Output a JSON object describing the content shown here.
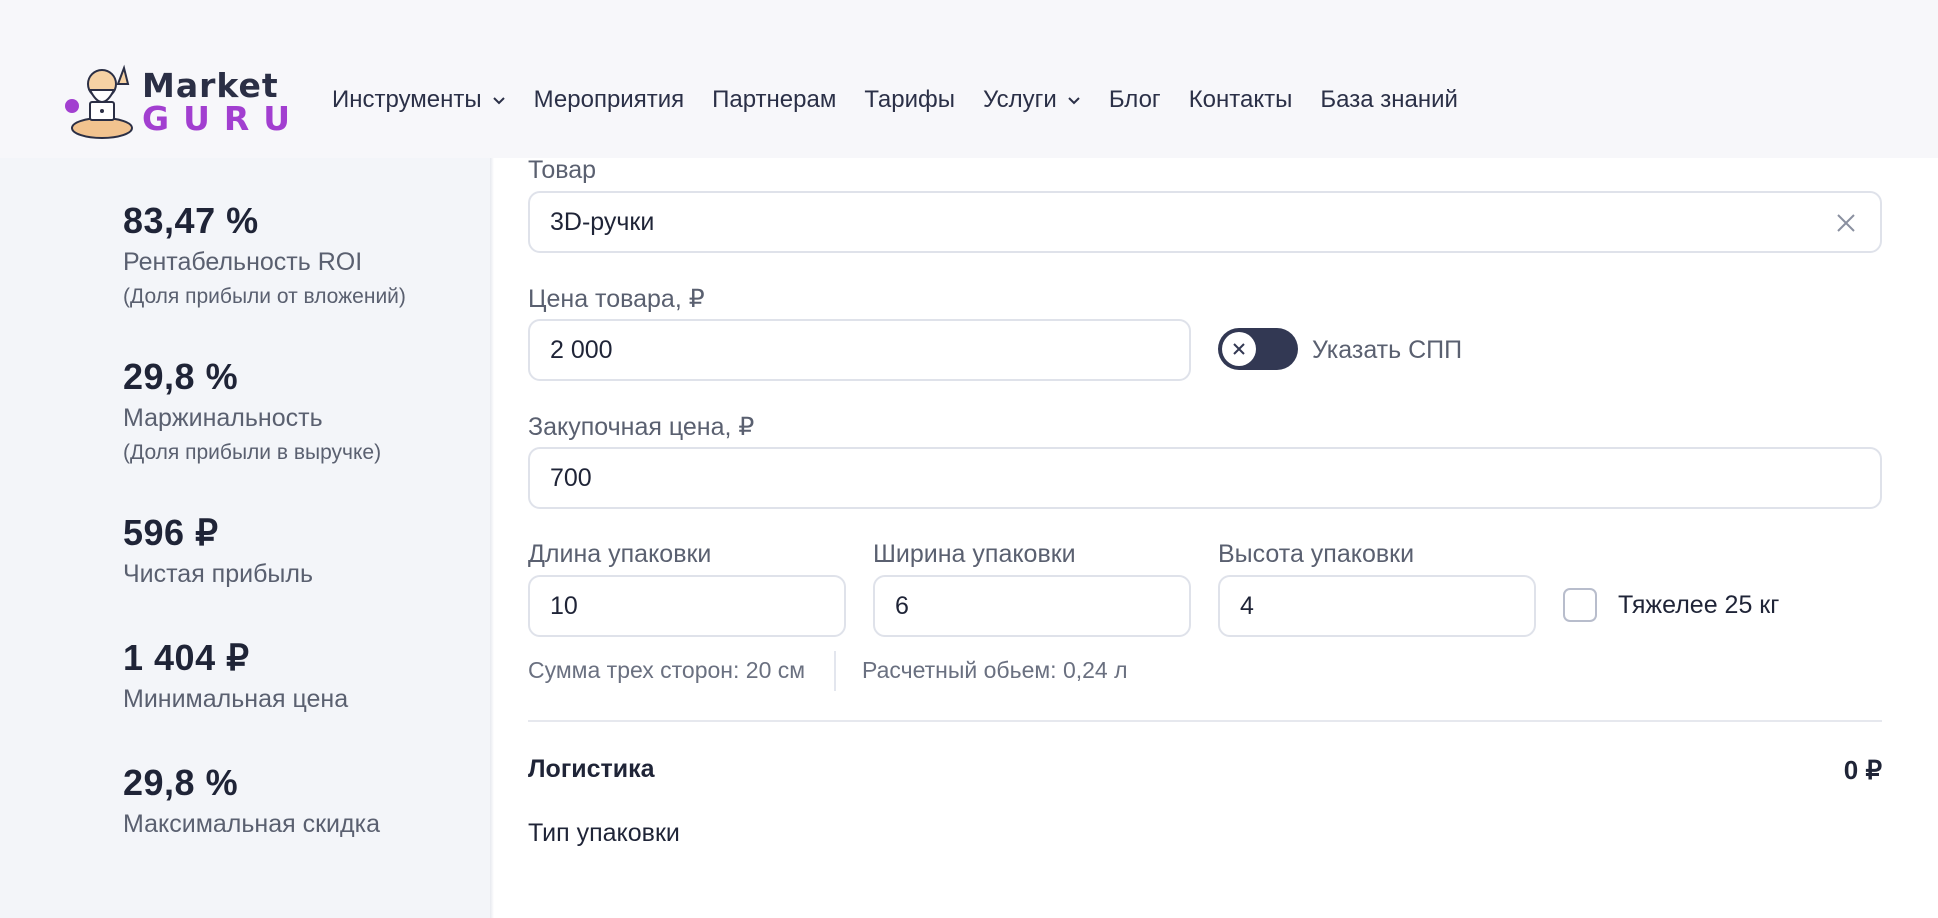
{
  "brand": {
    "line1": "Market",
    "line2": "GURU",
    "accent_color": "#a23fd0"
  },
  "nav": [
    {
      "label": "Инструменты",
      "dropdown": true
    },
    {
      "label": "Мероприятия",
      "dropdown": false
    },
    {
      "label": "Партнерам",
      "dropdown": false
    },
    {
      "label": "Тарифы",
      "dropdown": false
    },
    {
      "label": "Услуги",
      "dropdown": true
    },
    {
      "label": "Блог",
      "dropdown": false
    },
    {
      "label": "Контакты",
      "dropdown": false
    },
    {
      "label": "База знаний",
      "dropdown": false
    }
  ],
  "metrics": [
    {
      "value": "83,47 %",
      "label": "Рентабельность ROI",
      "sub": "(Доля прибыли от вложений)"
    },
    {
      "value": "29,8 %",
      "label": "Маржинальность",
      "sub": "(Доля прибыли в выручке)"
    },
    {
      "value": "596 ₽",
      "label": "Чистая прибыль",
      "sub": ""
    },
    {
      "value": "1 404 ₽",
      "label": "Минимальная цена",
      "sub": ""
    },
    {
      "value": "29,8 %",
      "label": "Максимальная скидка",
      "sub": ""
    }
  ],
  "form": {
    "product": {
      "label": "Товар",
      "value": "3D-ручки"
    },
    "price": {
      "label": "Цена товара, ₽",
      "value": "2 000"
    },
    "spp_toggle": {
      "label": "Указать СПП",
      "on": false
    },
    "purchase_price": {
      "label": "Закупочная цена, ₽",
      "value": "700"
    },
    "length": {
      "label": "Длина упаковки",
      "value": "10"
    },
    "width": {
      "label": "Ширина упаковки",
      "value": "6"
    },
    "height": {
      "label": "Высота упаковки",
      "value": "4"
    },
    "heavy": {
      "label": "Тяжелее 25 кг",
      "checked": false
    },
    "sum_sides": "Сумма трех сторон: 20 см",
    "volume": "Расчетный обьем: 0,24 л"
  },
  "logistics": {
    "title": "Логистика",
    "value": "0 ₽",
    "packaging_type_label": "Тип упаковки"
  }
}
